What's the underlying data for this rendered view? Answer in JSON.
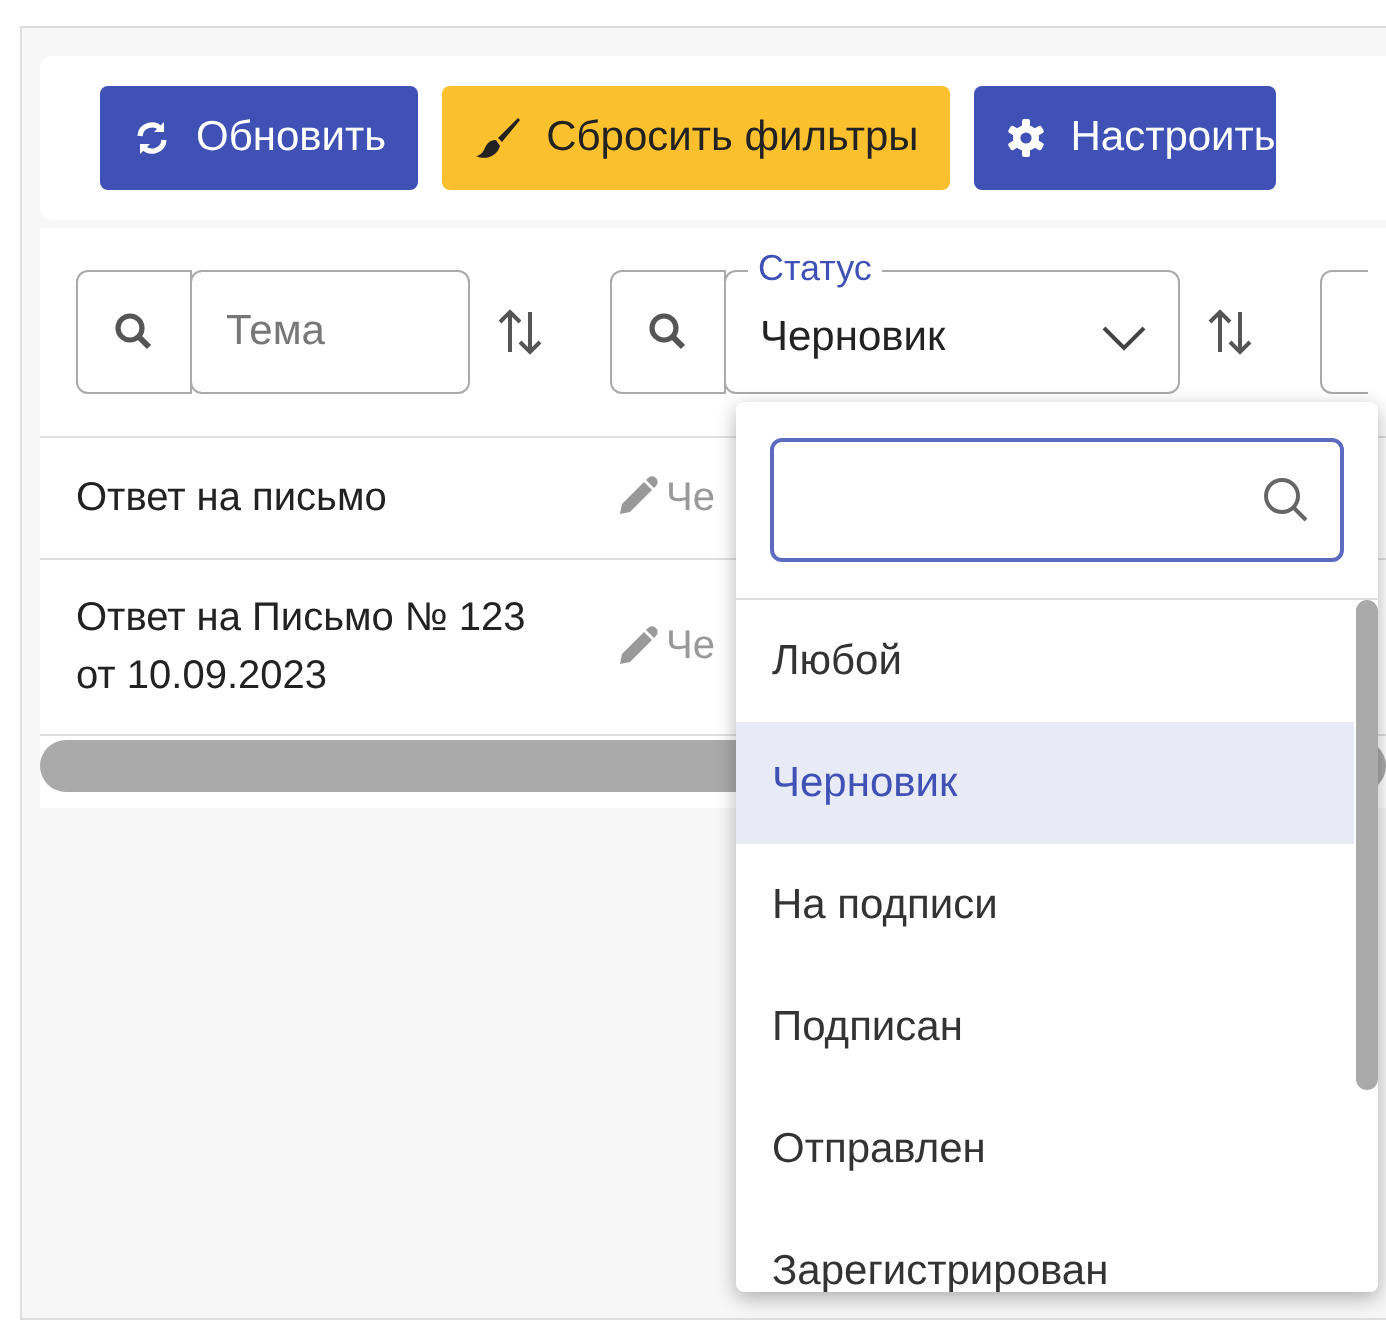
{
  "toolbar": {
    "buttons": [
      {
        "label": "Обновить",
        "kind": "refresh"
      },
      {
        "label": "Сбросить фильтры",
        "kind": "reset"
      },
      {
        "label": "Настроить",
        "kind": "settings"
      }
    ]
  },
  "filters": [
    {
      "kind": "text",
      "placeholder": "Тема"
    },
    {
      "kind": "select",
      "label": "Статус",
      "value": "Черновик",
      "expanded": true
    },
    {
      "kind": "cut"
    }
  ],
  "rows": [
    {
      "subject": "Ответ на письмо",
      "status": "Че"
    },
    {
      "subject": "Ответ на Письмо № 123 от 10.09.2023",
      "status": "Че"
    }
  ],
  "dropdown": {
    "options": [
      {
        "label": "Любой",
        "selected": false
      },
      {
        "label": "Черновик",
        "selected": true
      },
      {
        "label": "На подписи",
        "selected": false
      },
      {
        "label": "Подписан",
        "selected": false
      },
      {
        "label": "Отправлен",
        "selected": false
      },
      {
        "label": "Зарегистрирован",
        "selected": false
      }
    ]
  }
}
